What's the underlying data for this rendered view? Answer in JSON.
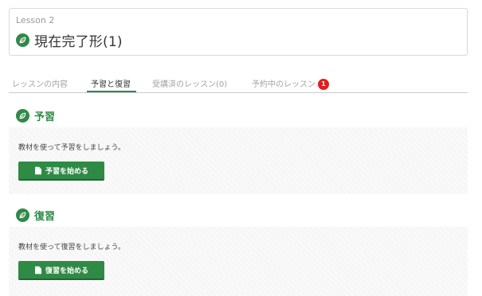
{
  "lesson": {
    "number_label": "Lesson 2",
    "title": "現在完了形(1)",
    "icon": "leaf-icon"
  },
  "tabs": [
    {
      "label": "レッスンの内容",
      "active": false
    },
    {
      "label": "予習と復習",
      "active": true
    },
    {
      "label": "受講済のレッスン(0)",
      "active": false
    },
    {
      "label": "予約中のレッスン",
      "active": false,
      "badge": "1"
    }
  ],
  "preview": {
    "heading": "予習",
    "description": "教材を使って予習をしましょう。",
    "button_label": "予習を始める",
    "button_icon": "document-icon"
  },
  "review": {
    "heading": "復習",
    "description": "教材を使って復習をしましょう。",
    "button_label": "復習を始める",
    "button_icon": "document-icon"
  },
  "colors": {
    "accent_green": "#2f8a46",
    "badge_red": "#e02020",
    "panel_bg": "#f6f6f6"
  }
}
